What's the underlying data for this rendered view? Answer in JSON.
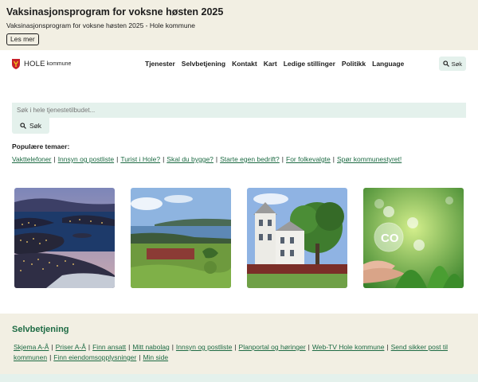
{
  "banner": {
    "title": "Vaksinasjonsprogram for voksne høsten 2025",
    "subtitle": "Vaksinasjonsprogram for voksne høsten 2025 - Hole kommune",
    "button_label": "Les mer"
  },
  "header": {
    "logo_name": "HOLE",
    "logo_suffix": "kommune",
    "nav": [
      "Tjenester",
      "Selvbetjening",
      "Kontakt",
      "Kart",
      "Ledige stillinger",
      "Politikk",
      "Language"
    ],
    "search_label": "Søk"
  },
  "search": {
    "placeholder": "Søk i hele tjenestetilbudet...",
    "button_label": "Søk"
  },
  "popular": {
    "title": "Populære temaer:",
    "links": [
      "Vakttelefoner",
      "Innsyn og postliste",
      "Turist i Hole?",
      "Skal du bygge?",
      "Starte egen bedrift?",
      "For folkevalgte",
      "Spør kommunestyret!"
    ]
  },
  "cards": [
    {
      "icon": "night-lake-photo"
    },
    {
      "icon": "lake-landscape-photo"
    },
    {
      "icon": "white-building-photo"
    },
    {
      "icon": "co2-plant-photo"
    }
  ],
  "selfservice": {
    "title": "Selvbetjening",
    "links": [
      "Skjema A-Å",
      "Priser A-Å",
      "Finn ansatt",
      "Mitt nabolag",
      "Innsyn og postliste",
      "Planportal og høringer",
      "Web-TV Hole kommune",
      "Send sikker post til kommunen",
      "Finn eiendomsopplysninger",
      "Min side"
    ]
  },
  "colors": {
    "banner_bg": "#f2efe3",
    "accent_green": "#1e6b44",
    "search_bg": "#e4f1ec"
  }
}
